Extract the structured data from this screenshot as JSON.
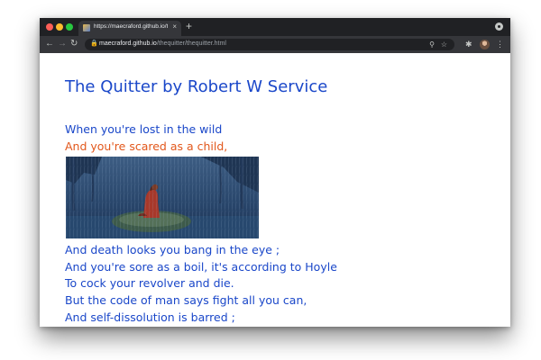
{
  "browser": {
    "tab_title": "https://maecraford.github.io/th",
    "tab_close": "×",
    "new_tab": "+",
    "url_host": "maecraford.github.io",
    "url_path": "/thequitter/thequitter.html",
    "icons": [
      "close-window",
      "minimize-window",
      "maximize-window",
      "favicon",
      "tab-close",
      "new-tab",
      "profile",
      "back",
      "forward",
      "reload",
      "lock",
      "zoom",
      "star",
      "extensions",
      "avatar",
      "menu"
    ]
  },
  "page": {
    "title": "The Quitter by Robert W Service",
    "lines": [
      "When you're lost in the wild",
      "And you're scared as a child,",
      "And death looks you bang in the eye ;",
      "And you're sore as a boil, it's according to Hoyle",
      "To cock your revolver and die.",
      "But the code of man says fight all you can,",
      "And self-dissolution is barred ;"
    ]
  },
  "colors": {
    "text": "#1a47c9",
    "highlight": "#e2571b",
    "chrome_dark": "#202124",
    "chrome_toolbar": "#35363a"
  }
}
